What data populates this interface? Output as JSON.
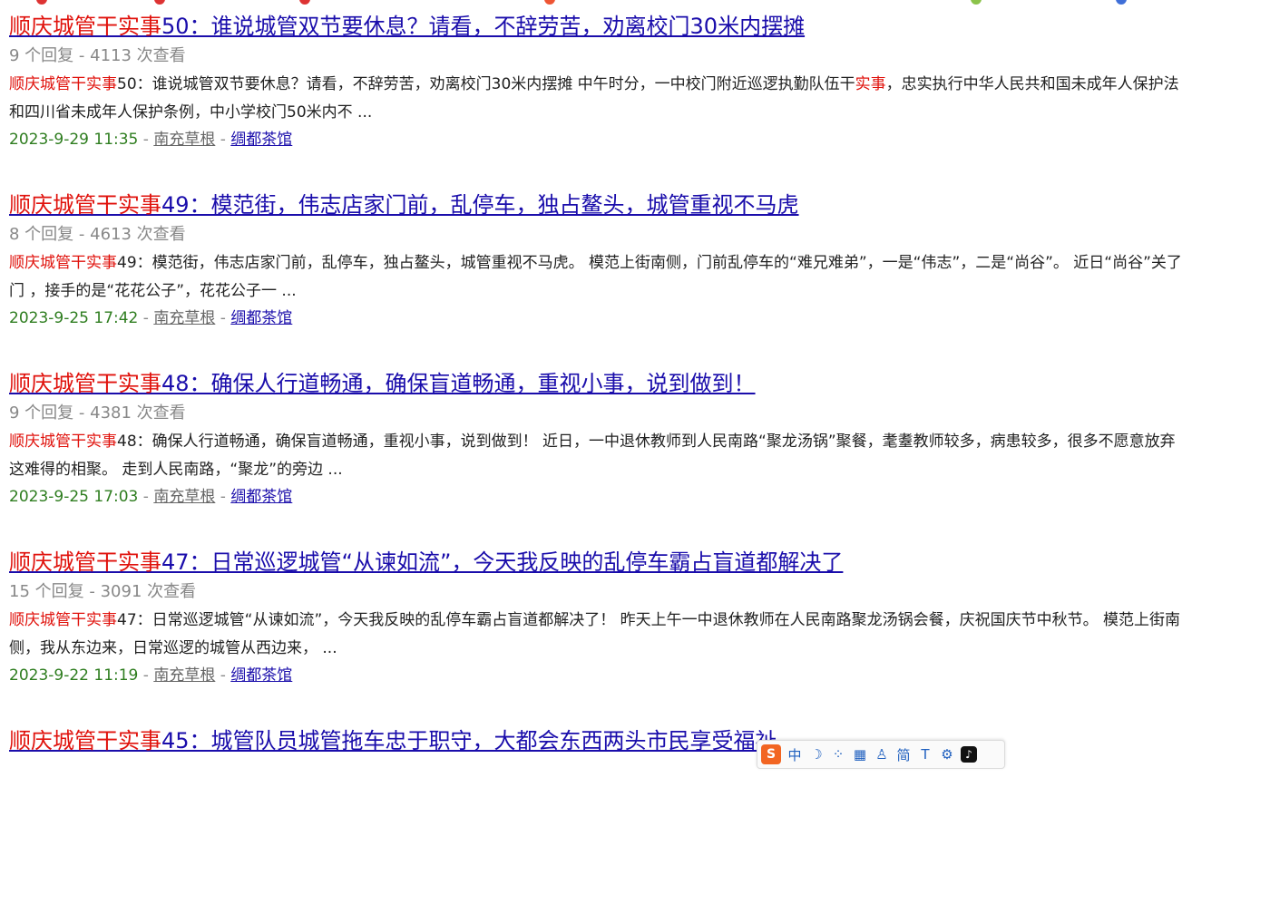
{
  "results": [
    {
      "title_highlight": "顺庆城管干实事",
      "title_rest": "50：谁说城管双节要休息？请看，不辞劳苦，劝离校门30米内摆摊",
      "replies": "9 个回复",
      "meta_sep": " - ",
      "views": "4113 次查看",
      "snippet_highlight": "顺庆城管干实事",
      "snippet_a": "50：谁说城管双节要休息？请看，不辞劳苦，劝离校门30米内摆摊 中午时分，一中校门附近巡逻执勤队伍干",
      "snippet_highlight2": "实事",
      "snippet_b": "，忠实执行中华人民共和国未成年人保护法和四川省未成年人保护条例，中小学校门50米内不 ...",
      "date": "2023-9-29 11:35",
      "author": "南充草根",
      "forum": "绸都茶馆"
    },
    {
      "title_highlight": "顺庆城管干实事",
      "title_rest": "49：模范街，伟志店家门前，乱停车，独占鳌头，城管重视不马虎",
      "replies": "8 个回复",
      "meta_sep": " - ",
      "views": "4613 次查看",
      "snippet_highlight": "顺庆城管干实事",
      "snippet_a": "49：模范街，伟志店家门前，乱停车，独占鳌头，城管重视不马虎。 模范上街南侧，门前乱停车的“难兄难弟”，一是“伟志”，二是“尚谷”。 近日“尚谷”关了门 ，接手的是“花花公子”，花花公子一 ...",
      "snippet_highlight2": "",
      "snippet_b": "",
      "date": "2023-9-25 17:42",
      "author": "南充草根",
      "forum": "绸都茶馆"
    },
    {
      "title_highlight": "顺庆城管干实事",
      "title_rest": "48：确保人行道畅通，确保盲道畅通，重视小事，说到做到！ ",
      "replies": "9 个回复",
      "meta_sep": " - ",
      "views": "4381 次查看",
      "snippet_highlight": "顺庆城管干实事",
      "snippet_a": "48：确保人行道畅通，确保盲道畅通，重视小事，说到做到！ 近日，一中退休教师到人民南路“聚龙汤锅”聚餐，耄耋教师较多，病患较多，很多不愿意放弃这难得的相聚。 走到人民南路，“聚龙”的旁边 ...",
      "snippet_highlight2": "",
      "snippet_b": "",
      "date": "2023-9-25 17:03",
      "author": "南充草根",
      "forum": "绸都茶馆"
    },
    {
      "title_highlight": "顺庆城管干实事",
      "title_rest": "47：日常巡逻城管“从谏如流”，今天我反映的乱停车霸占盲道都解决了",
      "replies": "15 个回复",
      "meta_sep": " - ",
      "views": "3091 次查看",
      "snippet_highlight": "顺庆城管干实事",
      "snippet_a": "47：日常巡逻城管“从谏如流”，今天我反映的乱停车霸占盲道都解决了！ 昨天上午一中退休教师在人民南路聚龙汤锅会餐，庆祝国庆节中秋节。 模范上街南侧，我从东边来，日常巡逻的城管从西边来， ...",
      "snippet_highlight2": "",
      "snippet_b": "",
      "date": "2023-9-22 11:19",
      "author": "南充草根",
      "forum": "绸都茶馆"
    },
    {
      "title_highlight": "顺庆城管干实事",
      "title_rest": "45：城管队员城管拖车忠于职守，大都会东西两头市民享受福祉",
      "replies": "",
      "meta_sep": "",
      "views": "",
      "snippet_highlight": "",
      "snippet_a": "",
      "snippet_highlight2": "",
      "snippet_b": "",
      "date": "",
      "author": "",
      "forum": ""
    }
  ],
  "ime": {
    "logo": "S",
    "lang": "中",
    "moon": "☽",
    "dots": "⁘",
    "keyboard": "▦",
    "user": "♙",
    "simplified": "简",
    "shirt": "T",
    "gear": "⚙",
    "tiktok": "♪"
  },
  "colors": {
    "link": "#1a0dab",
    "highlight": "#e0120c",
    "date": "#2e7d1f",
    "meta": "#888888"
  }
}
